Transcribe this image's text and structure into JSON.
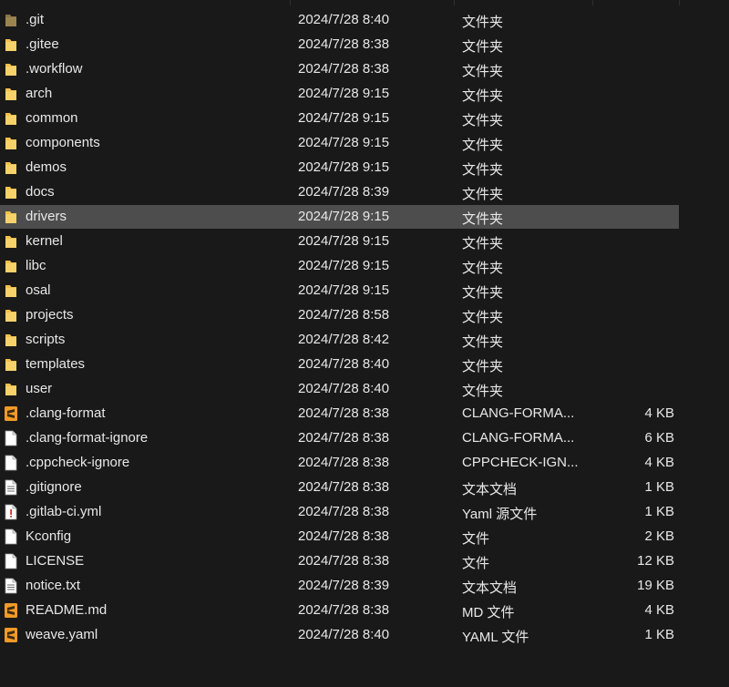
{
  "rows": [
    {
      "name": ".git",
      "date": "2024/7/28 8:40",
      "type": "文件夹",
      "size": "",
      "icon": "folder-hidden-icon"
    },
    {
      "name": ".gitee",
      "date": "2024/7/28 8:38",
      "type": "文件夹",
      "size": "",
      "icon": "folder-icon"
    },
    {
      "name": ".workflow",
      "date": "2024/7/28 8:38",
      "type": "文件夹",
      "size": "",
      "icon": "folder-icon"
    },
    {
      "name": "arch",
      "date": "2024/7/28 9:15",
      "type": "文件夹",
      "size": "",
      "icon": "folder-icon"
    },
    {
      "name": "common",
      "date": "2024/7/28 9:15",
      "type": "文件夹",
      "size": "",
      "icon": "folder-icon"
    },
    {
      "name": "components",
      "date": "2024/7/28 9:15",
      "type": "文件夹",
      "size": "",
      "icon": "folder-icon"
    },
    {
      "name": "demos",
      "date": "2024/7/28 9:15",
      "type": "文件夹",
      "size": "",
      "icon": "folder-icon"
    },
    {
      "name": "docs",
      "date": "2024/7/28 8:39",
      "type": "文件夹",
      "size": "",
      "icon": "folder-icon"
    },
    {
      "name": "drivers",
      "date": "2024/7/28 9:15",
      "type": "文件夹",
      "size": "",
      "icon": "folder-icon",
      "selected": true
    },
    {
      "name": "kernel",
      "date": "2024/7/28 9:15",
      "type": "文件夹",
      "size": "",
      "icon": "folder-icon"
    },
    {
      "name": "libc",
      "date": "2024/7/28 9:15",
      "type": "文件夹",
      "size": "",
      "icon": "folder-icon"
    },
    {
      "name": "osal",
      "date": "2024/7/28 9:15",
      "type": "文件夹",
      "size": "",
      "icon": "folder-icon"
    },
    {
      "name": "projects",
      "date": "2024/7/28 8:58",
      "type": "文件夹",
      "size": "",
      "icon": "folder-icon"
    },
    {
      "name": "scripts",
      "date": "2024/7/28 8:42",
      "type": "文件夹",
      "size": "",
      "icon": "folder-icon"
    },
    {
      "name": "templates",
      "date": "2024/7/28 8:40",
      "type": "文件夹",
      "size": "",
      "icon": "folder-icon"
    },
    {
      "name": "user",
      "date": "2024/7/28 8:40",
      "type": "文件夹",
      "size": "",
      "icon": "folder-icon"
    },
    {
      "name": ".clang-format",
      "date": "2024/7/28 8:38",
      "type": "CLANG-FORMA...",
      "size": "4 KB",
      "icon": "sublime-file-icon"
    },
    {
      "name": ".clang-format-ignore",
      "date": "2024/7/28 8:38",
      "type": "CLANG-FORMA...",
      "size": "6 KB",
      "icon": "blank-file-icon"
    },
    {
      "name": ".cppcheck-ignore",
      "date": "2024/7/28 8:38",
      "type": "CPPCHECK-IGN...",
      "size": "4 KB",
      "icon": "blank-file-icon"
    },
    {
      "name": ".gitignore",
      "date": "2024/7/28 8:38",
      "type": "文本文档",
      "size": "1 KB",
      "icon": "text-file-icon"
    },
    {
      "name": ".gitlab-ci.yml",
      "date": "2024/7/28 8:38",
      "type": "Yaml 源文件",
      "size": "1 KB",
      "icon": "warning-file-icon"
    },
    {
      "name": "Kconfig",
      "date": "2024/7/28 8:38",
      "type": "文件",
      "size": "2 KB",
      "icon": "blank-file-icon"
    },
    {
      "name": "LICENSE",
      "date": "2024/7/28 8:38",
      "type": "文件",
      "size": "12 KB",
      "icon": "blank-file-icon"
    },
    {
      "name": "notice.txt",
      "date": "2024/7/28 8:39",
      "type": "文本文档",
      "size": "19 KB",
      "icon": "text-file-icon"
    },
    {
      "name": "README.md",
      "date": "2024/7/28 8:38",
      "type": "MD 文件",
      "size": "4 KB",
      "icon": "sublime-file-icon"
    },
    {
      "name": "weave.yaml",
      "date": "2024/7/28 8:40",
      "type": "YAML 文件",
      "size": "1 KB",
      "icon": "sublime-file-icon"
    }
  ],
  "colors": {
    "background": "#191919",
    "selected": "#4d4d4d",
    "text": "#e8e8e8",
    "folder": "#f2c14e",
    "folder_hidden": "#9c8450",
    "sublime": "#f09a28"
  }
}
